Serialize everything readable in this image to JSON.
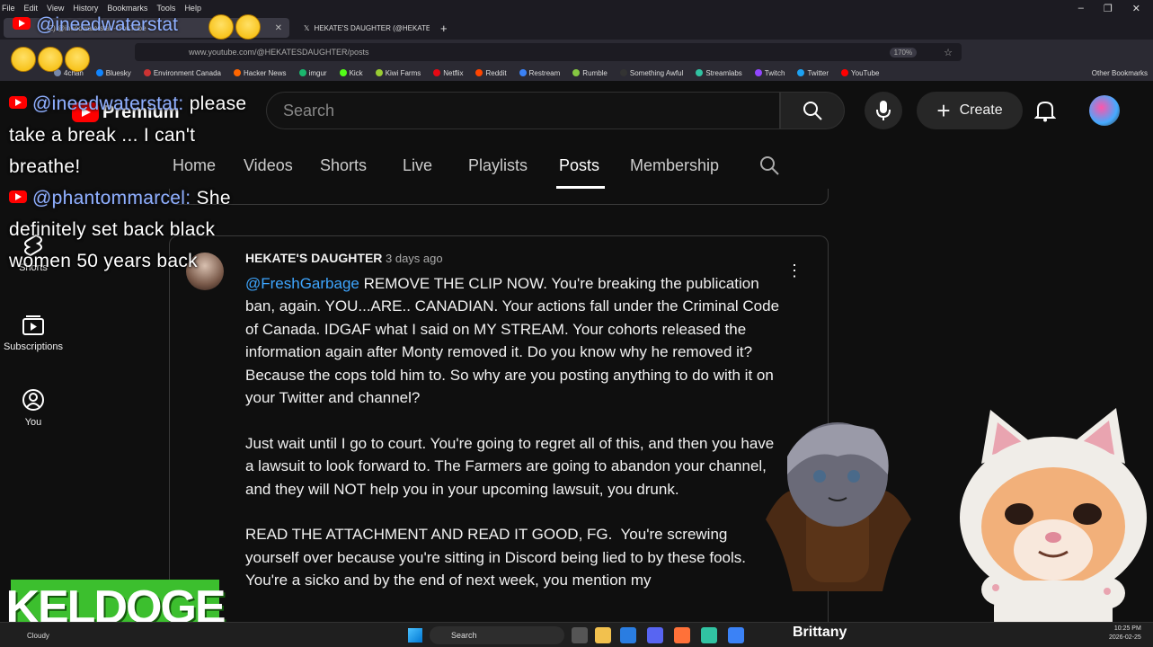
{
  "browser": {
    "menu": [
      "File",
      "Edit",
      "View",
      "History",
      "Bookmarks",
      "Tools",
      "Help"
    ],
    "tabs": [
      {
        "label": "(2) @ineedwaterstat - YouTube"
      },
      {
        "label": "HEKATE'S DAUGHTER (@HEKATE",
        "active": true
      }
    ],
    "url": "www.youtube.com/@HEKATESDAUGHTER/posts",
    "zoom": "170%",
    "bookmarks": [
      {
        "label": "4chan",
        "color": "#78a"
      },
      {
        "label": "Bluesky",
        "color": "#1185fe"
      },
      {
        "label": "Environment Canada",
        "color": "#c33"
      },
      {
        "label": "Hacker News",
        "color": "#f60"
      },
      {
        "label": "imgur",
        "color": "#1bb76e"
      },
      {
        "label": "Kick",
        "color": "#53fc18"
      },
      {
        "label": "Kiwi Farms",
        "color": "#9c3"
      },
      {
        "label": "Netflix",
        "color": "#e50914"
      },
      {
        "label": "Reddit",
        "color": "#ff4500"
      },
      {
        "label": "Restream",
        "color": "#3b82f6"
      },
      {
        "label": "Rumble",
        "color": "#85c742"
      },
      {
        "label": "Something Awful",
        "color": "#333"
      },
      {
        "label": "Streamlabs",
        "color": "#31c3a2"
      },
      {
        "label": "Twitch",
        "color": "#9146ff"
      },
      {
        "label": "Twitter",
        "color": "#1da1f2"
      },
      {
        "label": "YouTube",
        "color": "#f00"
      }
    ],
    "other_bookmarks": "Other Bookmarks"
  },
  "youtube": {
    "logo_text": "Premium",
    "search_placeholder": "Search",
    "create_label": "Create",
    "channel_tabs": [
      {
        "label": "Home"
      },
      {
        "label": "Videos"
      },
      {
        "label": "Shorts"
      },
      {
        "label": "Live"
      },
      {
        "label": "Playlists"
      },
      {
        "label": "Posts",
        "active": true
      },
      {
        "label": "Membership"
      }
    ],
    "sidebar": [
      {
        "label": "Shorts"
      },
      {
        "label": "Subscriptions"
      },
      {
        "label": "You"
      }
    ]
  },
  "post": {
    "author": "HEKATE'S DAUGHTER",
    "time": "3 days ago",
    "mention": "@FreshGarbage",
    "body_p1": " REMOVE THE CLIP NOW. You're breaking the publication ban, again. YOU...ARE.. CANADIAN. Your actions fall under the Criminal Code of Canada. IDGAF what I said on MY STREAM. Your cohorts released the information again after Monty removed it. Do you know why he removed it?  Because the cops told him to. So why are you posting anything to do with it on your Twitter and channel?",
    "body_p2": "Just wait until I go to court. You're going to regret all of this, and then you have a lawsuit to look forward to. The Farmers are going to abandon your channel, and they will NOT help you in your upcoming lawsuit, you drunk.",
    "body_p3": "READ THE ATTACHMENT AND READ IT GOOD, FG.  You're screwing yourself over because you're sitting in Discord being lied to by these fools.  You're a sicko and by the end of next week, you mention my"
  },
  "overlay": {
    "top_user": "@ineedwaterstat",
    "chat": [
      {
        "user": "@ineedwaterstat:",
        "message": "please take a break ... I can't breathe!"
      },
      {
        "user": "@phantommarcel:",
        "message": "She definitely set back black women 50 years back"
      }
    ],
    "watermark": "KELDOGE"
  },
  "taskbar": {
    "weather": "Cloudy",
    "search": "Search",
    "label": "Brittany",
    "time": "10:25 PM",
    "date": "2026-02-25"
  }
}
